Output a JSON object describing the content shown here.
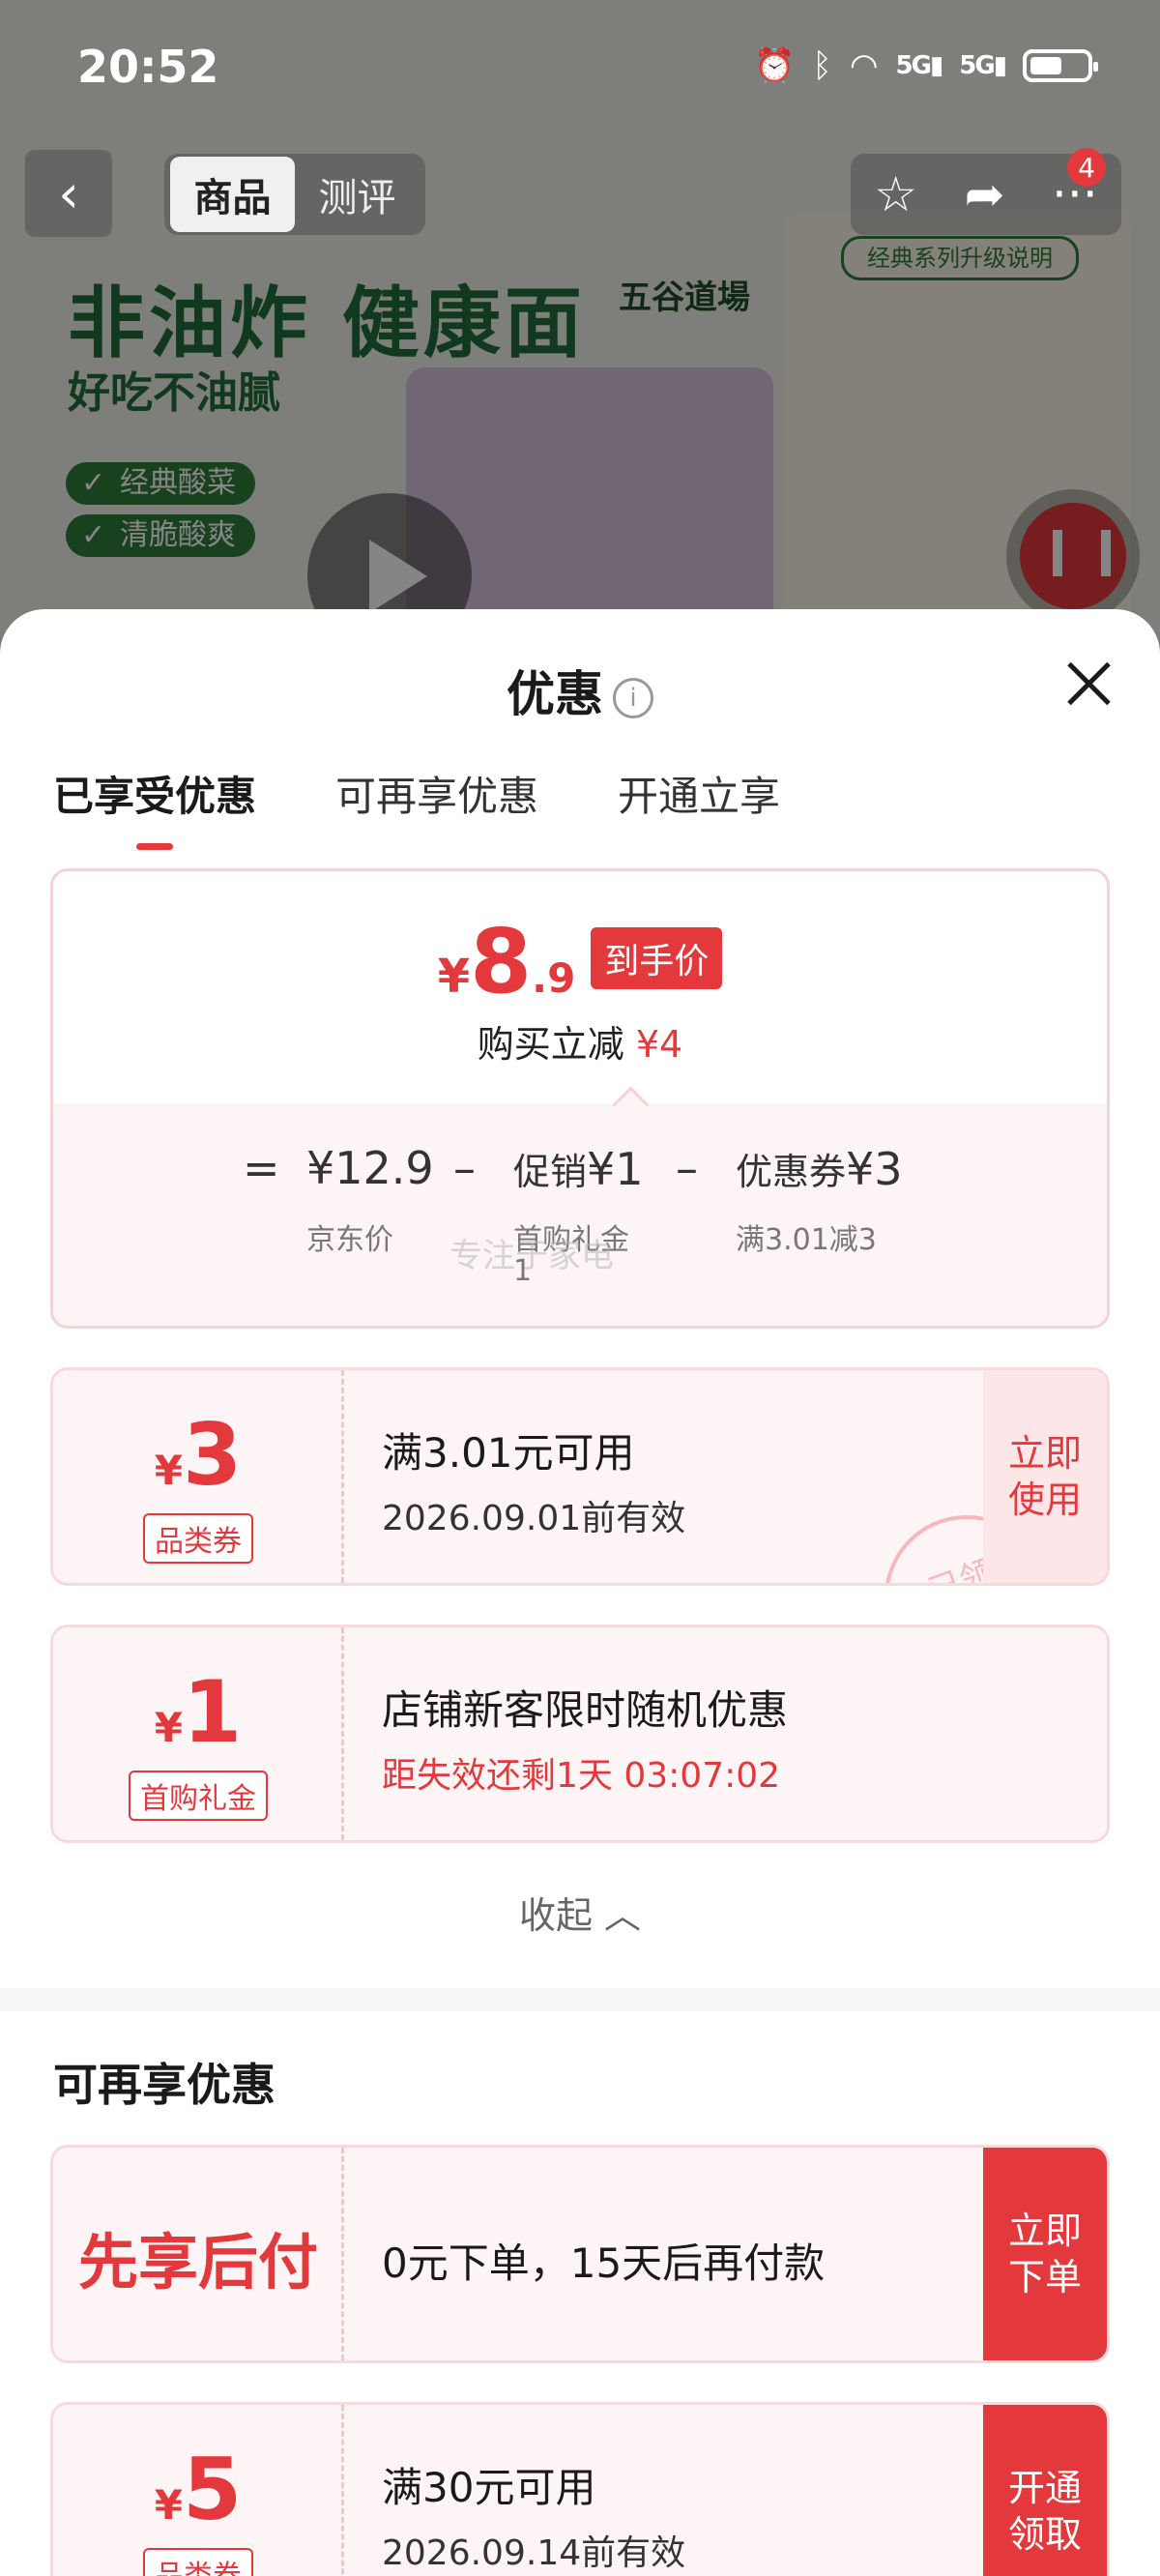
{
  "status_bar": {
    "time": "20:52",
    "signal1": "5G",
    "signal2": "5G"
  },
  "product_page": {
    "tabs": [
      "商品",
      "测评"
    ],
    "active_tab": "商品",
    "cart_badge": "4",
    "hero_title": "非油炸 健康面",
    "hero_subtitle": "好吃不油腻",
    "brand": "五谷道場",
    "flavors": [
      "经典酸菜",
      "清脆酸爽"
    ],
    "thumb_title": "经典系列升级说明"
  },
  "sheet": {
    "title": "优惠",
    "tabs": [
      "已享受优惠",
      "可再享优惠",
      "开通立享"
    ],
    "active_tab": "已享受优惠",
    "summary": {
      "yen": "¥",
      "price_int": "8",
      "price_dec": ".9",
      "price_tag": "到手价",
      "reduce_label": "购买立减",
      "reduce_amount": "¥4",
      "eq": "=",
      "jd_price": "¥12.9",
      "jd_label": "京东价",
      "minus1": "–",
      "promo_label": "促销",
      "promo_amount": "¥1",
      "promo_sub_line1": "首购礼金",
      "promo_sub_line2": "1",
      "minus2": "–",
      "coupon_label": "优惠券",
      "coupon_amount": "¥3",
      "coupon_sub": "满3.01减3",
      "watermark": "专注于家电"
    },
    "coupons_used": [
      {
        "yen": "¥",
        "amount": "3",
        "tag": "品类券",
        "title": "满3.01元可用",
        "subtitle": "2026.09.01前有效",
        "action": "立即使用",
        "stamp": "已领"
      },
      {
        "yen": "¥",
        "amount": "1",
        "tag": "首购礼金",
        "title": "店铺新客限时随机优惠",
        "subtitle": "距失效还剩1天 03:07:02"
      }
    ],
    "collapse_label": "收起",
    "more_section_title": "可再享优惠",
    "coupons_more": [
      {
        "big_label": "先享后付",
        "title": "0元下单，15天后再付款",
        "action": "立即下单"
      },
      {
        "yen": "¥",
        "amount": "5",
        "tag": "品类券",
        "title": "满30元可用",
        "subtitle": "2026.09.14前有效",
        "action": "开通领取"
      }
    ]
  },
  "colors": {
    "accent_red": "#e4393c",
    "brand_green": "#1f6e3a"
  }
}
